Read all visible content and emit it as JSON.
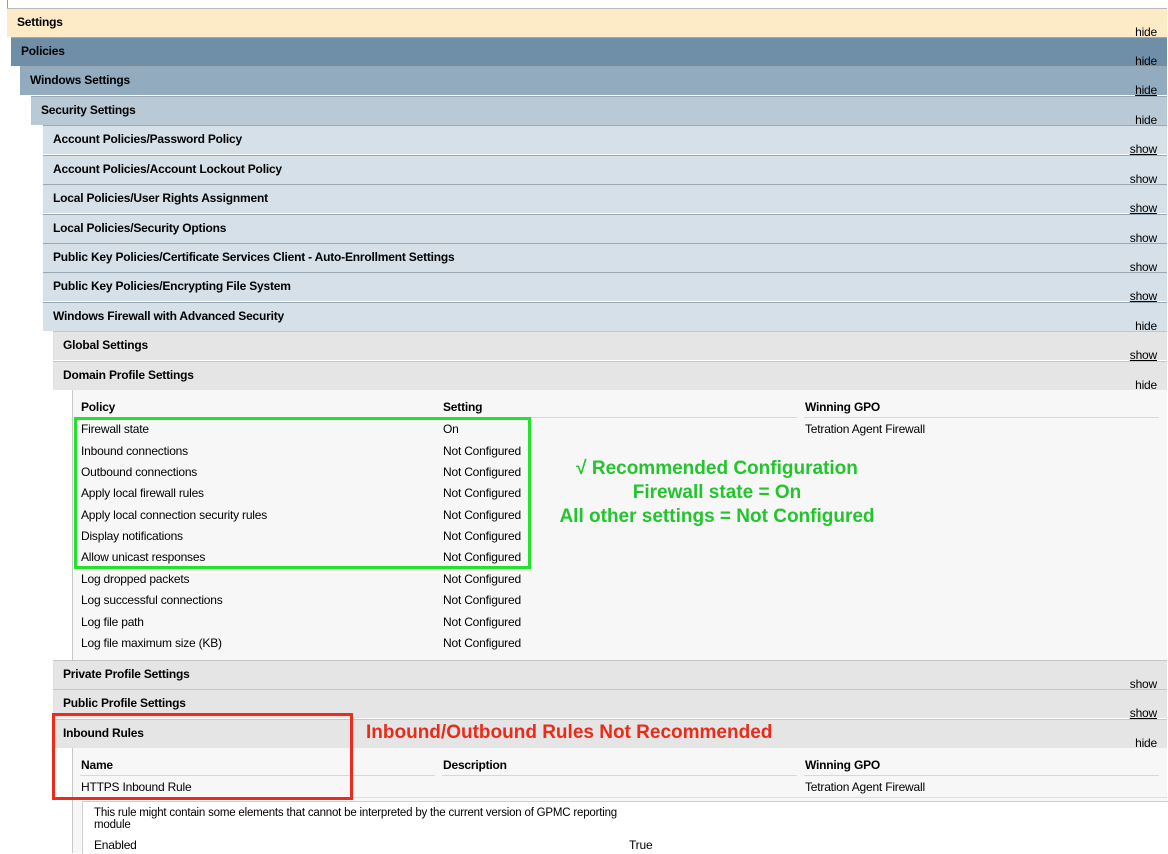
{
  "sections": {
    "settings": {
      "title": "Settings",
      "action": "hide"
    },
    "policies": {
      "title": "Policies",
      "action": "hide"
    },
    "windows_settings": {
      "title": "Windows Settings",
      "action": "hide"
    },
    "security_settings": {
      "title": "Security Settings",
      "action": "hide"
    },
    "password_policy": {
      "title": "Account Policies/Password Policy",
      "action": "show"
    },
    "lockout_policy": {
      "title": "Account Policies/Account Lockout Policy",
      "action": "show"
    },
    "user_rights": {
      "title": "Local Policies/User Rights Assignment",
      "action": "show"
    },
    "security_options": {
      "title": "Local Policies/Security Options",
      "action": "show"
    },
    "autoenroll": {
      "title": "Public Key Policies/Certificate Services Client - Auto-Enrollment Settings",
      "action": "show"
    },
    "efs": {
      "title": "Public Key Policies/Encrypting File System",
      "action": "show"
    },
    "firewall": {
      "title": "Windows Firewall with Advanced Security",
      "action": "hide"
    },
    "global": {
      "title": "Global Settings",
      "action": "show"
    },
    "domain_profile": {
      "title": "Domain Profile Settings",
      "action": "hide"
    },
    "private_profile": {
      "title": "Private Profile Settings",
      "action": "show"
    },
    "public_profile": {
      "title": "Public Profile Settings",
      "action": "show"
    },
    "inbound_rules": {
      "title": "Inbound Rules",
      "action": "hide"
    }
  },
  "domain_table": {
    "headers": {
      "policy": "Policy",
      "setting": "Setting",
      "gpo": "Winning GPO"
    },
    "rows": [
      {
        "policy": "Firewall state",
        "setting": "On",
        "gpo": "Tetration Agent Firewall"
      },
      {
        "policy": "Inbound connections",
        "setting": "Not Configured",
        "gpo": ""
      },
      {
        "policy": "Outbound connections",
        "setting": "Not Configured",
        "gpo": ""
      },
      {
        "policy": "Apply local firewall rules",
        "setting": "Not Configured",
        "gpo": ""
      },
      {
        "policy": "Apply local connection security rules",
        "setting": "Not Configured",
        "gpo": ""
      },
      {
        "policy": "Display notifications",
        "setting": "Not Configured",
        "gpo": ""
      },
      {
        "policy": "Allow unicast responses",
        "setting": "Not Configured",
        "gpo": ""
      },
      {
        "policy": "Log dropped packets",
        "setting": "Not Configured",
        "gpo": ""
      },
      {
        "policy": "Log successful connections",
        "setting": "Not Configured",
        "gpo": ""
      },
      {
        "policy": "Log file path",
        "setting": "Not Configured",
        "gpo": ""
      },
      {
        "policy": "Log file maximum size (KB)",
        "setting": "Not Configured",
        "gpo": ""
      }
    ]
  },
  "rules_table": {
    "headers": {
      "name": "Name",
      "description": "Description",
      "gpo": "Winning GPO"
    },
    "rows": [
      {
        "name": "HTTPS Inbound Rule",
        "description": "",
        "gpo": "Tetration Agent Firewall"
      }
    ],
    "detail": {
      "note": "This rule might contain some elements that cannot be interpreted by the current version of GPMC reporting module",
      "enabled_label": "Enabled",
      "enabled_value": "True"
    }
  },
  "annotations": {
    "recommended": {
      "line1": "√ Recommended Configuration",
      "line2": "Firewall state = On",
      "line3": "All other settings = Not Configured",
      "color": "#22c62c"
    },
    "not_recommended": {
      "text": "Inbound/Outbound Rules Not Recommended",
      "color": "#ec2a17"
    }
  }
}
